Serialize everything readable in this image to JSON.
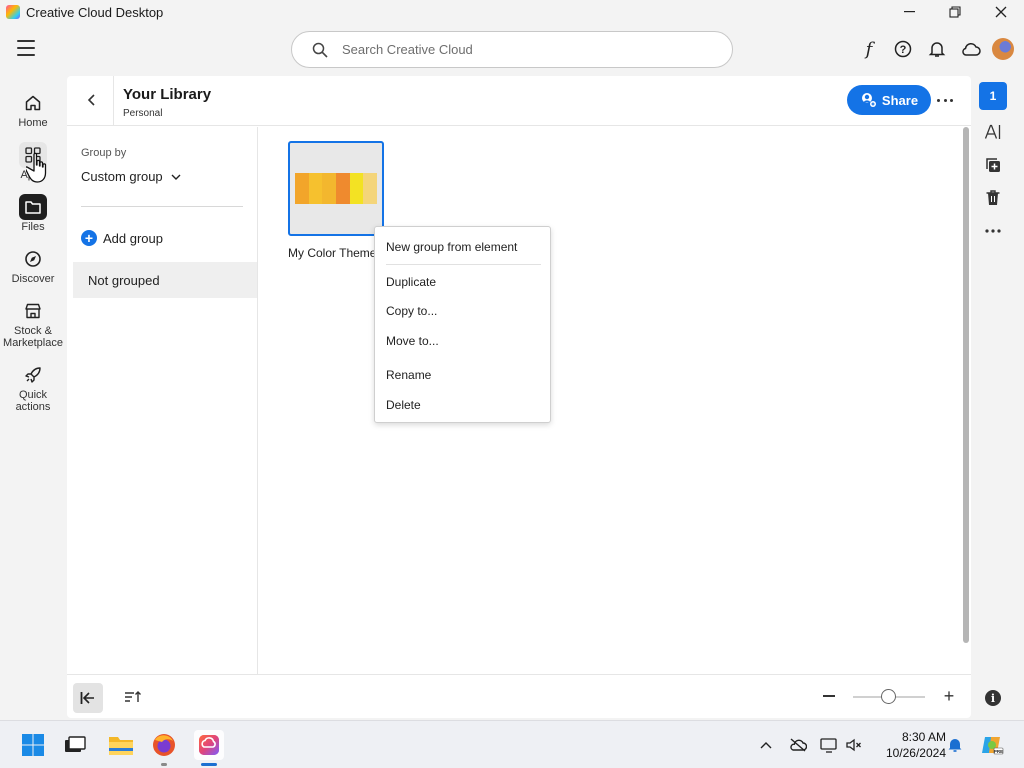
{
  "window": {
    "title": "Creative Cloud Desktop",
    "controls": {
      "minimize": "–",
      "maximize": "❐",
      "close": "✕"
    }
  },
  "topbar": {
    "search": {
      "placeholder": "Search Creative Cloud",
      "value": ""
    },
    "icons": [
      "fonts-icon",
      "help-icon",
      "notifications-icon",
      "cloud-icon",
      "avatar"
    ]
  },
  "leftnav": {
    "items": [
      {
        "label": "Home",
        "icon": "home-icon",
        "active": false
      },
      {
        "label": "Apps",
        "icon": "apps-icon",
        "active": false
      },
      {
        "label": "Files",
        "icon": "folder-icon",
        "active": true
      },
      {
        "label": "Discover",
        "icon": "discover-icon",
        "active": false
      },
      {
        "label": "Stock & Marketplace",
        "icon": "store-icon",
        "active": false
      },
      {
        "label": "Quick actions",
        "icon": "rocket-icon",
        "active": false
      }
    ]
  },
  "library": {
    "title": "Your Library",
    "subtitle": "Personal",
    "share_label": "Share"
  },
  "groups": {
    "group_by_label": "Group by",
    "group_by_value": "Custom group",
    "add_group_label": "Add group",
    "not_grouped_label": "Not grouped"
  },
  "element": {
    "name": "My Color Theme",
    "colors": [
      "#f2a52a",
      "#f6c12e",
      "#f3b72e",
      "#ef8a2e",
      "#f3e223",
      "#f4d57a"
    ]
  },
  "context_menu": {
    "items": [
      "New group from element",
      "Duplicate",
      "Copy to...",
      "Move to...",
      "Rename",
      "Delete"
    ]
  },
  "rightrail": {
    "badge": "1",
    "icons": [
      "text-style-icon",
      "add-element-icon",
      "trash-icon",
      "more-icon"
    ]
  },
  "taskbar": {
    "time": "8:30 AM",
    "date": "10/26/2024"
  },
  "colors": {
    "accent": "#1473e6",
    "panel": "#ffffff",
    "background": "#f3f3f3"
  }
}
